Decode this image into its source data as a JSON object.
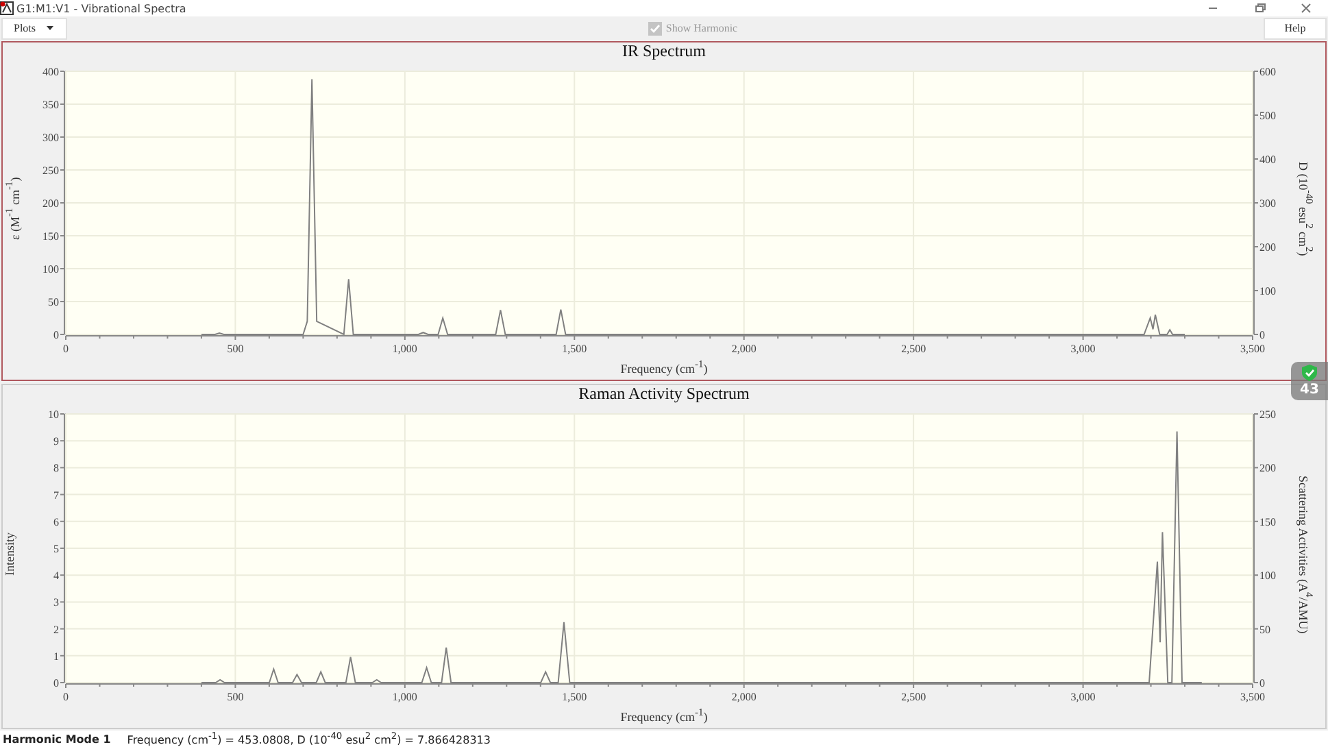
{
  "window": {
    "title": "G1:M1:V1 - Vibrational Spectra"
  },
  "toolbar": {
    "plots_button": "Plots",
    "show_harmonic": {
      "label": "Show Harmonic",
      "checked": true,
      "disabled": true
    },
    "help_button": "Help"
  },
  "panels": [
    {
      "title": "IR Spectrum",
      "selected": true,
      "chart_data": {
        "type": "line",
        "grid": true,
        "xlabel": "Frequency (cm$^{-1}$)",
        "ylabel": "ε (M$^{-1}$ cm$^{-1}$)",
        "y2label": "D (10$^{-40}$ esu$^{2}$ cm$^{2}$)",
        "xlim": [
          0,
          3500
        ],
        "ylim": [
          0,
          400
        ],
        "y2lim": [
          0,
          600
        ],
        "xticks": [
          {
            "value": 0,
            "label": "0"
          },
          {
            "value": 500,
            "label": "500"
          },
          {
            "value": 1000,
            "label": "1,000"
          },
          {
            "value": 1500,
            "label": "1,500"
          },
          {
            "value": 2000,
            "label": "2,000"
          },
          {
            "value": 2500,
            "label": "2,500"
          },
          {
            "value": 3000,
            "label": "3,000"
          },
          {
            "value": 3500,
            "label": "3,500"
          }
        ],
        "yticks": [
          0,
          50,
          100,
          150,
          200,
          250,
          300,
          350,
          400
        ],
        "y2ticks": [
          0,
          100,
          200,
          300,
          400,
          500,
          600
        ],
        "x": [
          400,
          440,
          453,
          466,
          700,
          712,
          726,
          740,
          820,
          834,
          848,
          1040,
          1054,
          1068,
          1098,
          1112,
          1126,
          1268,
          1282,
          1296,
          1446,
          1460,
          1474,
          3180,
          3198,
          3206,
          3213,
          3226,
          3248,
          3256,
          3264,
          3300
        ],
        "series": [
          {
            "color": "#808080",
            "values": [
              0,
              0,
              2,
              0,
              0,
              20,
              388,
              20,
              0,
              84,
              0,
              0,
              3,
              0,
              0,
              25,
              0,
              0,
              37,
              0,
              0,
              38,
              0,
              0,
              25,
              8,
              30,
              0,
              0,
              7,
              0,
              0
            ]
          }
        ]
      }
    },
    {
      "title": "Raman Activity Spectrum",
      "selected": false,
      "chart_data": {
        "type": "line",
        "grid": true,
        "xlabel": "Frequency (cm$^{-1}$)",
        "ylabel": "Intensity",
        "y2label": "Scattering Activities (A$^{4}$/AMU)",
        "xlim": [
          0,
          3500
        ],
        "ylim": [
          0,
          10
        ],
        "y2lim": [
          0,
          250
        ],
        "xticks": [
          {
            "value": 0,
            "label": "0"
          },
          {
            "value": 500,
            "label": "500"
          },
          {
            "value": 1000,
            "label": "1,000"
          },
          {
            "value": 1500,
            "label": "1,500"
          },
          {
            "value": 2000,
            "label": "2,000"
          },
          {
            "value": 2500,
            "label": "2,500"
          },
          {
            "value": 3000,
            "label": "3,000"
          },
          {
            "value": 3500,
            "label": "3,500"
          }
        ],
        "yticks": [
          0,
          1,
          2,
          3,
          4,
          5,
          6,
          7,
          8,
          9,
          10
        ],
        "y2ticks": [
          0,
          50,
          100,
          150,
          200,
          250
        ],
        "x": [
          400,
          442,
          455,
          468,
          600,
          613,
          626,
          669,
          682,
          695,
          739,
          752,
          765,
          826,
          840,
          854,
          904,
          917,
          930,
          1050,
          1064,
          1078,
          1108,
          1122,
          1136,
          1401,
          1415,
          1429,
          1452,
          1469,
          1486,
          3195,
          3219,
          3227,
          3234,
          3250,
          3262,
          3277,
          3292,
          3350
        ],
        "series": [
          {
            "color": "#808080",
            "values": [
              0,
              0,
              0.1,
              0,
              0,
              0.5,
              0,
              0,
              0.3,
              0,
              0,
              0.4,
              0,
              0,
              0.95,
              0,
              0,
              0.1,
              0,
              0,
              0.55,
              0,
              0,
              1.3,
              0,
              0,
              0.4,
              0,
              0,
              2.25,
              0,
              0,
              4.5,
              1.5,
              5.6,
              0,
              0,
              9.35,
              0,
              0
            ]
          }
        ]
      }
    }
  ],
  "status_bar": {
    "mode": "Harmonic Mode 1",
    "details": "Frequency (cm$^{-1}$) = 453.0808, D (10$^{-40}$ esu$^{2}$ cm$^{2}$) = 7.866428313"
  },
  "overlay": {
    "value": "43"
  }
}
